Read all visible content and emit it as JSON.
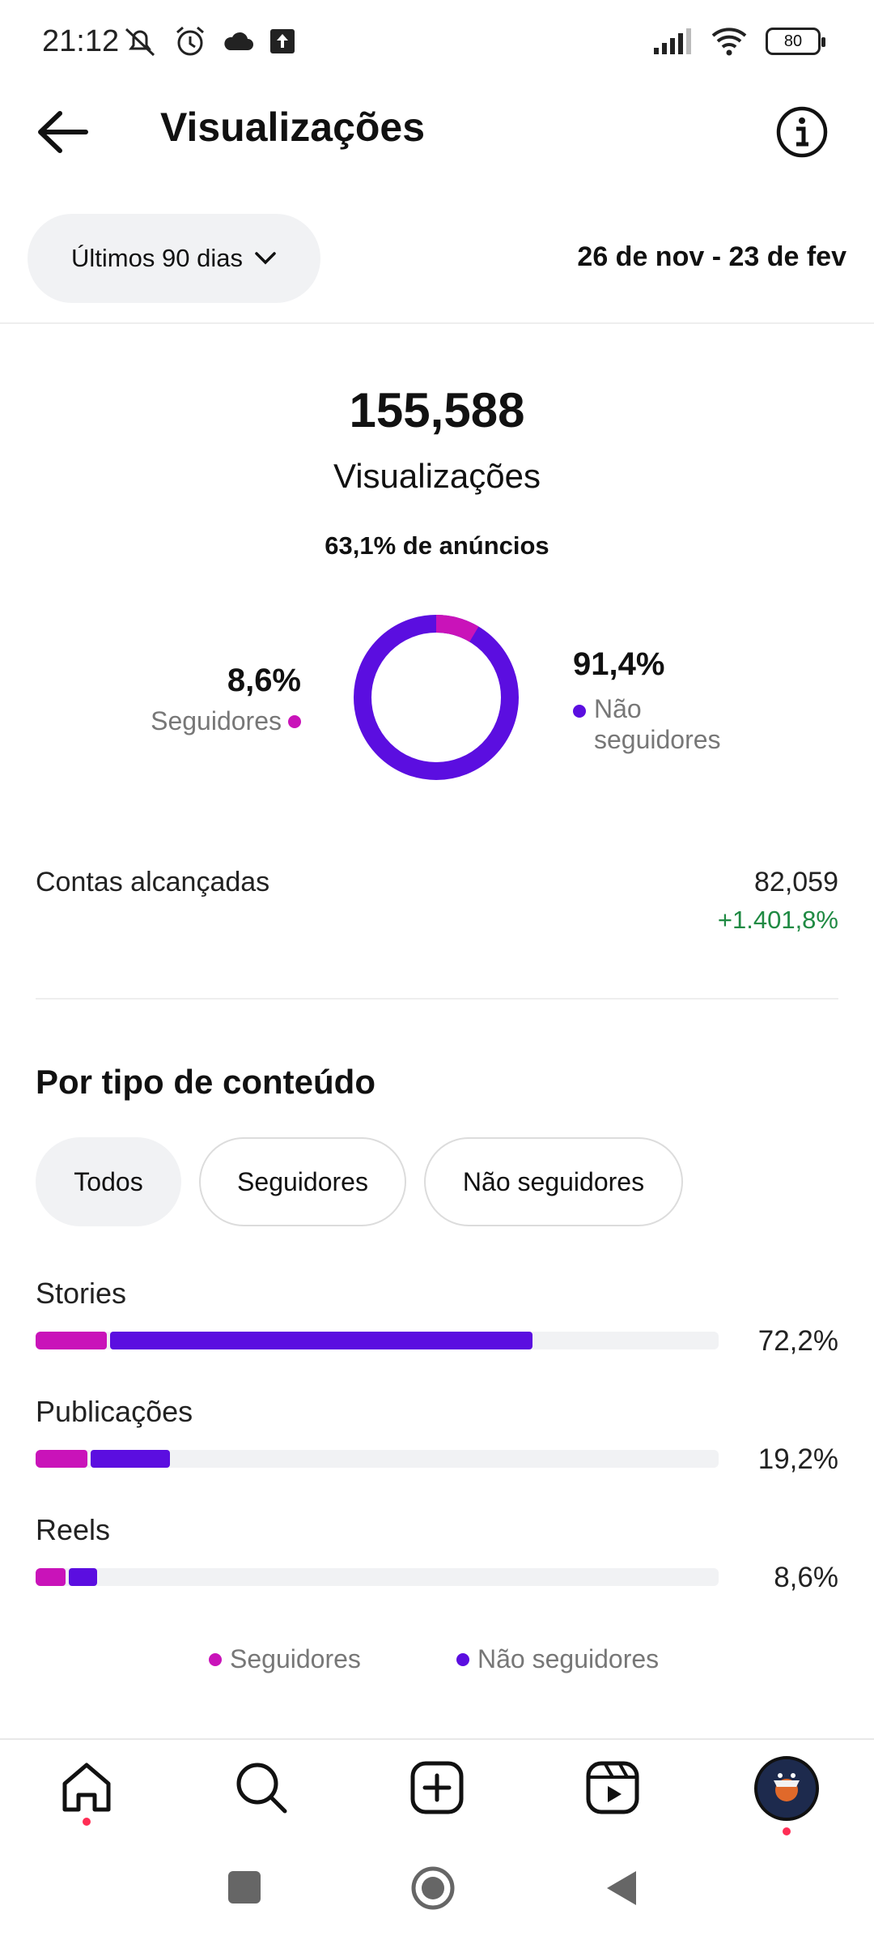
{
  "status_bar": {
    "time": "21:12",
    "battery": "80"
  },
  "header": {
    "title": "Visualizações"
  },
  "period": {
    "selector_label": "Últimos 90 dias",
    "date_range": "26 de nov - 23 de fev"
  },
  "summary": {
    "total": "155,588",
    "total_label": "Visualizações",
    "ads_note": "63,1% de anúncios",
    "followers_pct": "8,6%",
    "followers_label": "Seguidores",
    "non_followers_pct": "91,4%",
    "non_followers_label": "Não seguidores",
    "followers_fraction": 0.086
  },
  "reach": {
    "label": "Contas alcançadas",
    "value": "82,059",
    "change": "+1.401,8%"
  },
  "content_type": {
    "title": "Por tipo de conteúdo",
    "filters": [
      "Todos",
      "Seguidores",
      "Não seguidores"
    ],
    "active_filter": "Todos",
    "rows": [
      {
        "label": "Stories",
        "pct": "72,2%",
        "followers_fraction": 0.104,
        "non_followers_fraction": 0.618
      },
      {
        "label": "Publicações",
        "pct": "19,2%",
        "followers_fraction": 0.076,
        "non_followers_fraction": 0.116
      },
      {
        "label": "Reels",
        "pct": "8,6%",
        "followers_fraction": 0.044,
        "non_followers_fraction": 0.042
      }
    ],
    "legend": {
      "followers": "Seguidores",
      "non_followers": "Não seguidores"
    }
  },
  "colors": {
    "followers": "#c913b9",
    "non_followers": "#5b0ee0",
    "positive": "#1f8a43"
  },
  "bottom_nav": [
    "home-icon",
    "search-icon",
    "create-icon",
    "reels-icon",
    "profile-avatar"
  ]
}
